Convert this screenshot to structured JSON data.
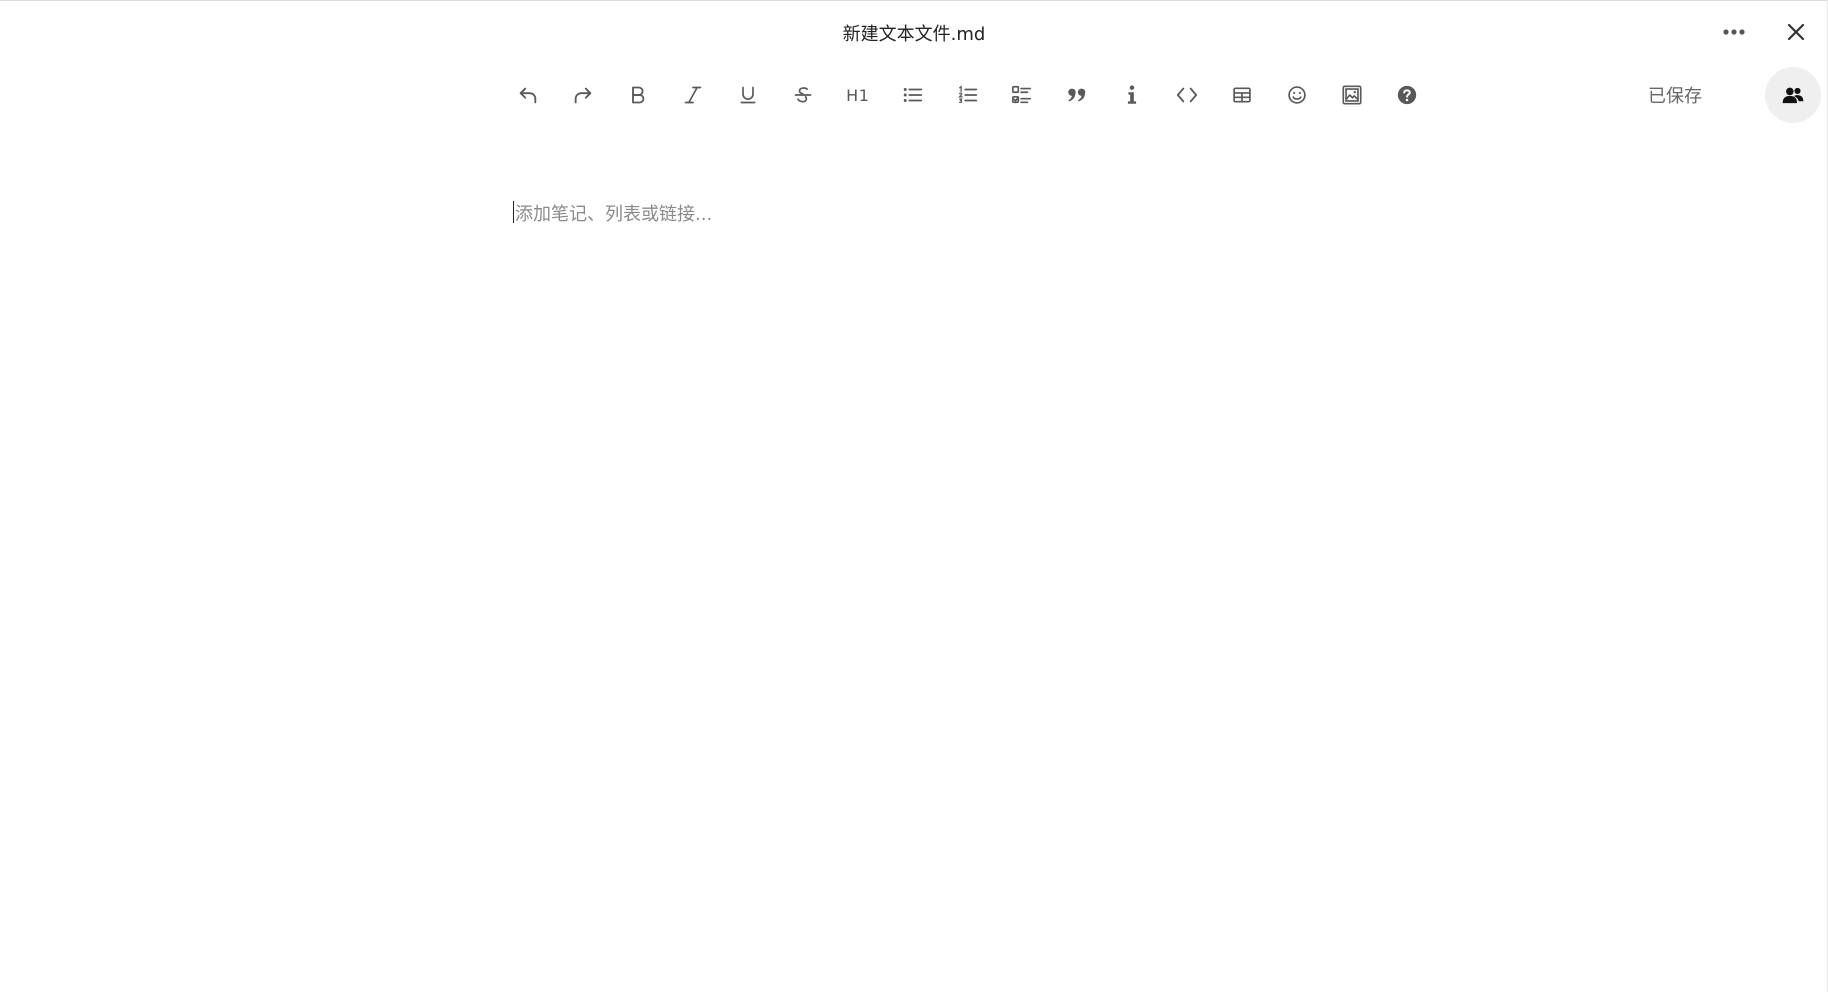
{
  "header": {
    "title": "新建文本文件.md",
    "more_icon": "more-horizontal-icon",
    "close_icon": "close-icon"
  },
  "toolbar": {
    "items": [
      {
        "icon": "undo-icon"
      },
      {
        "icon": "redo-icon"
      },
      {
        "icon": "bold-icon"
      },
      {
        "icon": "italic-icon"
      },
      {
        "icon": "underline-icon"
      },
      {
        "icon": "strikethrough-icon"
      },
      {
        "icon": "heading-icon",
        "label": "H1"
      },
      {
        "icon": "bullet-list-icon"
      },
      {
        "icon": "ordered-list-icon"
      },
      {
        "icon": "checklist-icon"
      },
      {
        "icon": "quote-icon"
      },
      {
        "icon": "info-icon"
      },
      {
        "icon": "code-icon"
      },
      {
        "icon": "table-icon"
      },
      {
        "icon": "emoji-icon"
      },
      {
        "icon": "image-icon"
      },
      {
        "icon": "help-icon"
      }
    ],
    "status": "已保存",
    "collaborators_icon": "users-icon"
  },
  "editor": {
    "placeholder": "添加笔记、列表或链接..."
  },
  "colors": {
    "icon": "#595959",
    "text": "#222222",
    "placeholder": "#8a8a8a",
    "avatar_bg": "#efefef"
  }
}
